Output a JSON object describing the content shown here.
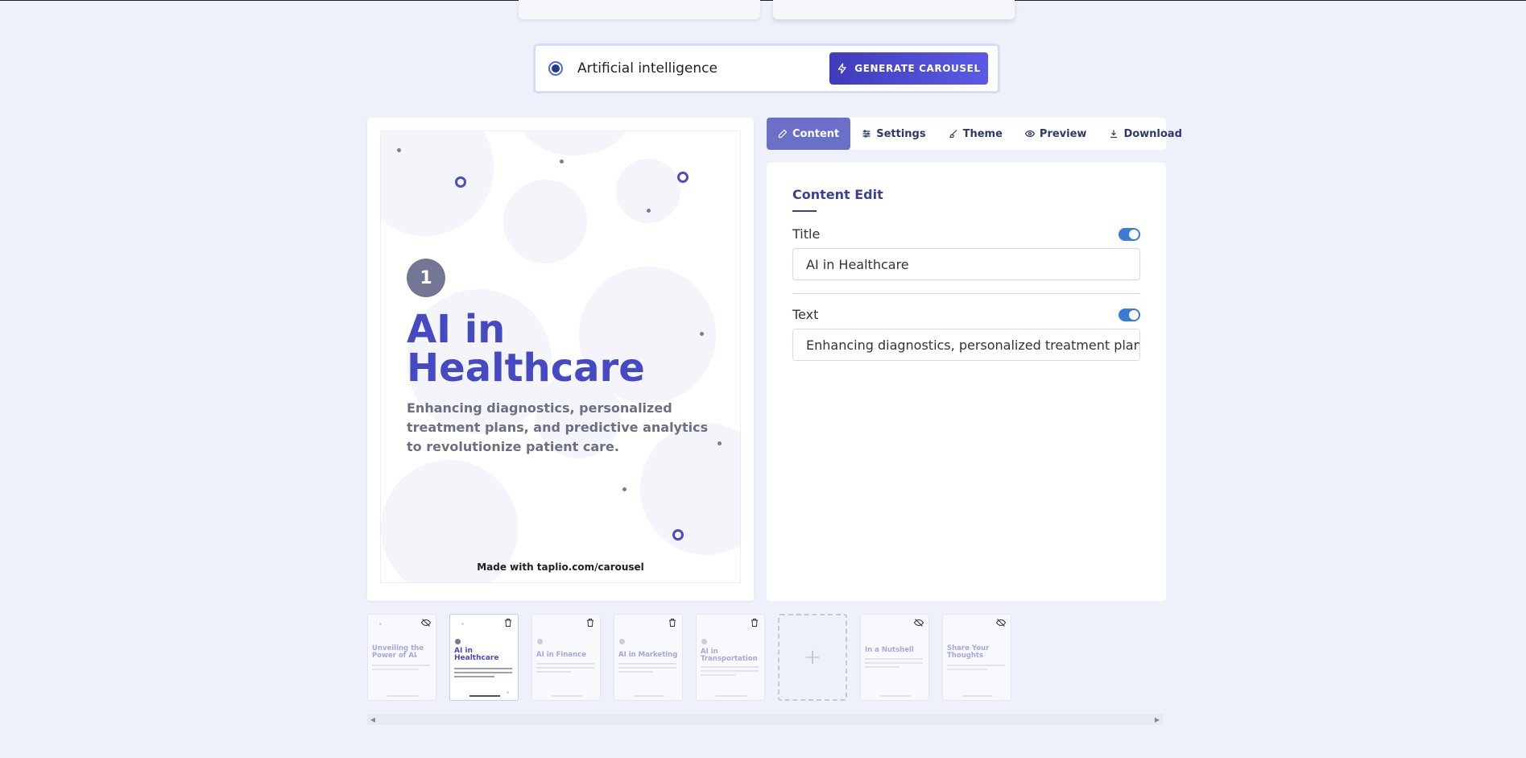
{
  "generator": {
    "topic": "Artificial intelligence",
    "button_label": "GENERATE CAROUSEL"
  },
  "tabs": [
    {
      "label": "Content",
      "icon": "pencil-icon",
      "active": true
    },
    {
      "label": "Settings",
      "icon": "sliders-icon",
      "active": false
    },
    {
      "label": "Theme",
      "icon": "brush-icon",
      "active": false
    },
    {
      "label": "Preview",
      "icon": "eye-icon",
      "active": false
    },
    {
      "label": "Download",
      "icon": "download-icon",
      "active": false
    }
  ],
  "panel": {
    "heading": "Content Edit",
    "title_label": "Title",
    "title_value": "AI in Healthcare",
    "text_label": "Text",
    "text_value": "Enhancing diagnostics, personalized treatment plans, and predictive analytics to revolutionize patient care."
  },
  "slide": {
    "number": "1",
    "title": "AI in Healthcare",
    "text": "Enhancing diagnostics, personalized treatment plans, and predictive analytics to revolutionize patient care.",
    "footer": "Made with taplio.com/carousel"
  },
  "thumbnails": [
    {
      "title": "Unveiling the Power of AI",
      "icon": "eye-off-icon",
      "numbered": false,
      "selected": false
    },
    {
      "title": "AI in Healthcare",
      "icon": "trash-icon",
      "numbered": true,
      "selected": true
    },
    {
      "title": "AI in Finance",
      "icon": "trash-icon",
      "numbered": true,
      "selected": false
    },
    {
      "title": "AI in Marketing",
      "icon": "trash-icon",
      "numbered": true,
      "selected": false
    },
    {
      "title": "AI in Transportation",
      "icon": "trash-icon",
      "numbered": true,
      "selected": false
    },
    {
      "add": true,
      "label": "+"
    },
    {
      "title": "In a Nutshell",
      "icon": "eye-off-icon",
      "numbered": false,
      "selected": false
    },
    {
      "title": "Share Your Thoughts",
      "icon": "eye-off-icon",
      "numbered": false,
      "selected": false
    }
  ],
  "colors": {
    "accent": "#4549c2",
    "tab_active": "#6a6fc7",
    "toggle_on": "#3a7bd5",
    "background": "#eef0fb"
  }
}
